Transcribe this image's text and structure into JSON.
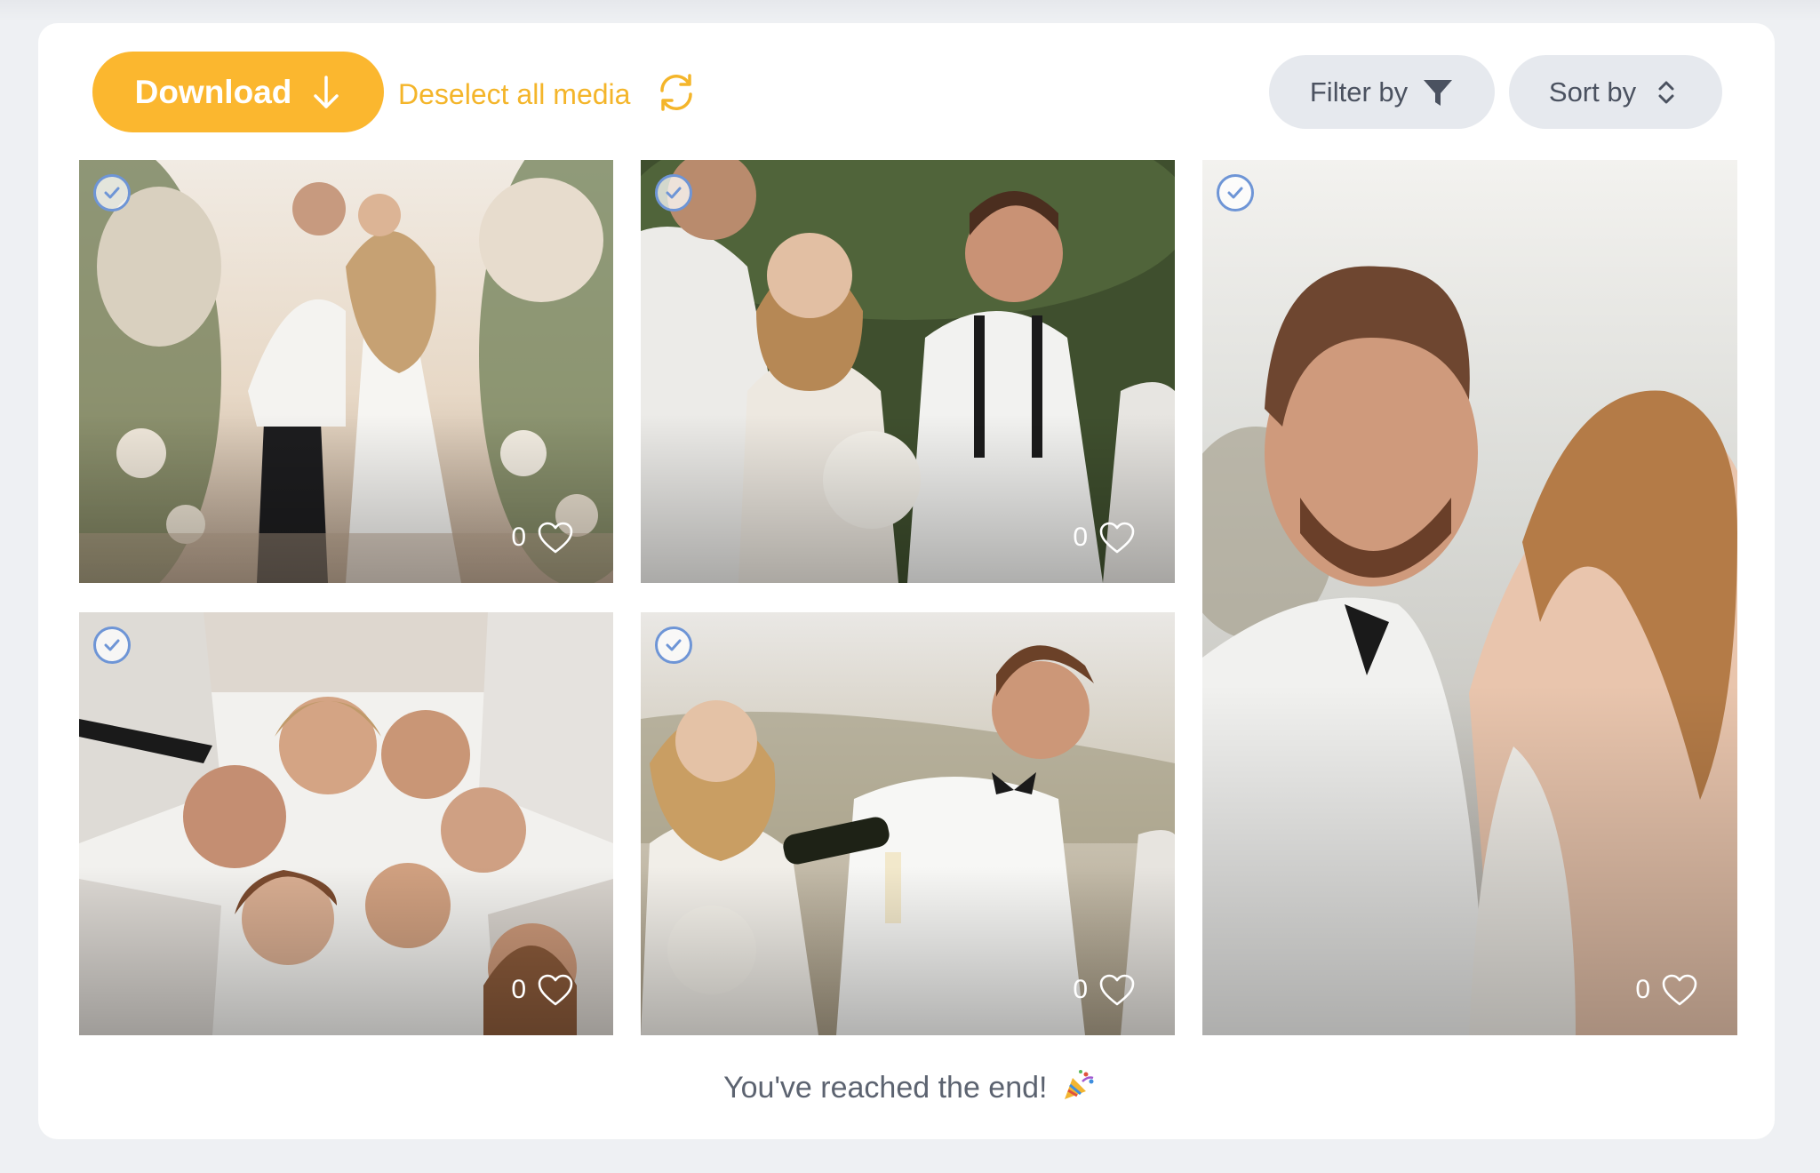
{
  "toolbar": {
    "download_label": "Download",
    "deselect_label": "Deselect all media",
    "filter_label": "Filter by",
    "sort_label": "Sort by"
  },
  "icons": {
    "download": "arrow-down-icon",
    "refresh": "refresh-icon",
    "filter": "funnel-icon",
    "sort": "sort-chevrons-icon",
    "select": "check-circle-icon",
    "like": "heart-icon",
    "end": "party-popper-icon"
  },
  "colors": {
    "accent": "#fbb72f",
    "link": "#f4b52a",
    "pill_bg": "#e6e9ee",
    "check": "#6e95d6"
  },
  "media": [
    {
      "photo": "couple embracing under floral arch",
      "selected": true,
      "likes": "0"
    },
    {
      "photo": "bride and groom toasting with guests",
      "selected": true,
      "likes": "0"
    },
    {
      "photo": "groom smiling portrait with bride",
      "selected": true,
      "likes": "0"
    },
    {
      "photo": "group huddle looking down at camera",
      "selected": true,
      "likes": "0"
    },
    {
      "photo": "groom pouring champagne for bride",
      "selected": true,
      "likes": "0"
    }
  ],
  "footer": {
    "end_message": "You've reached the end!"
  }
}
